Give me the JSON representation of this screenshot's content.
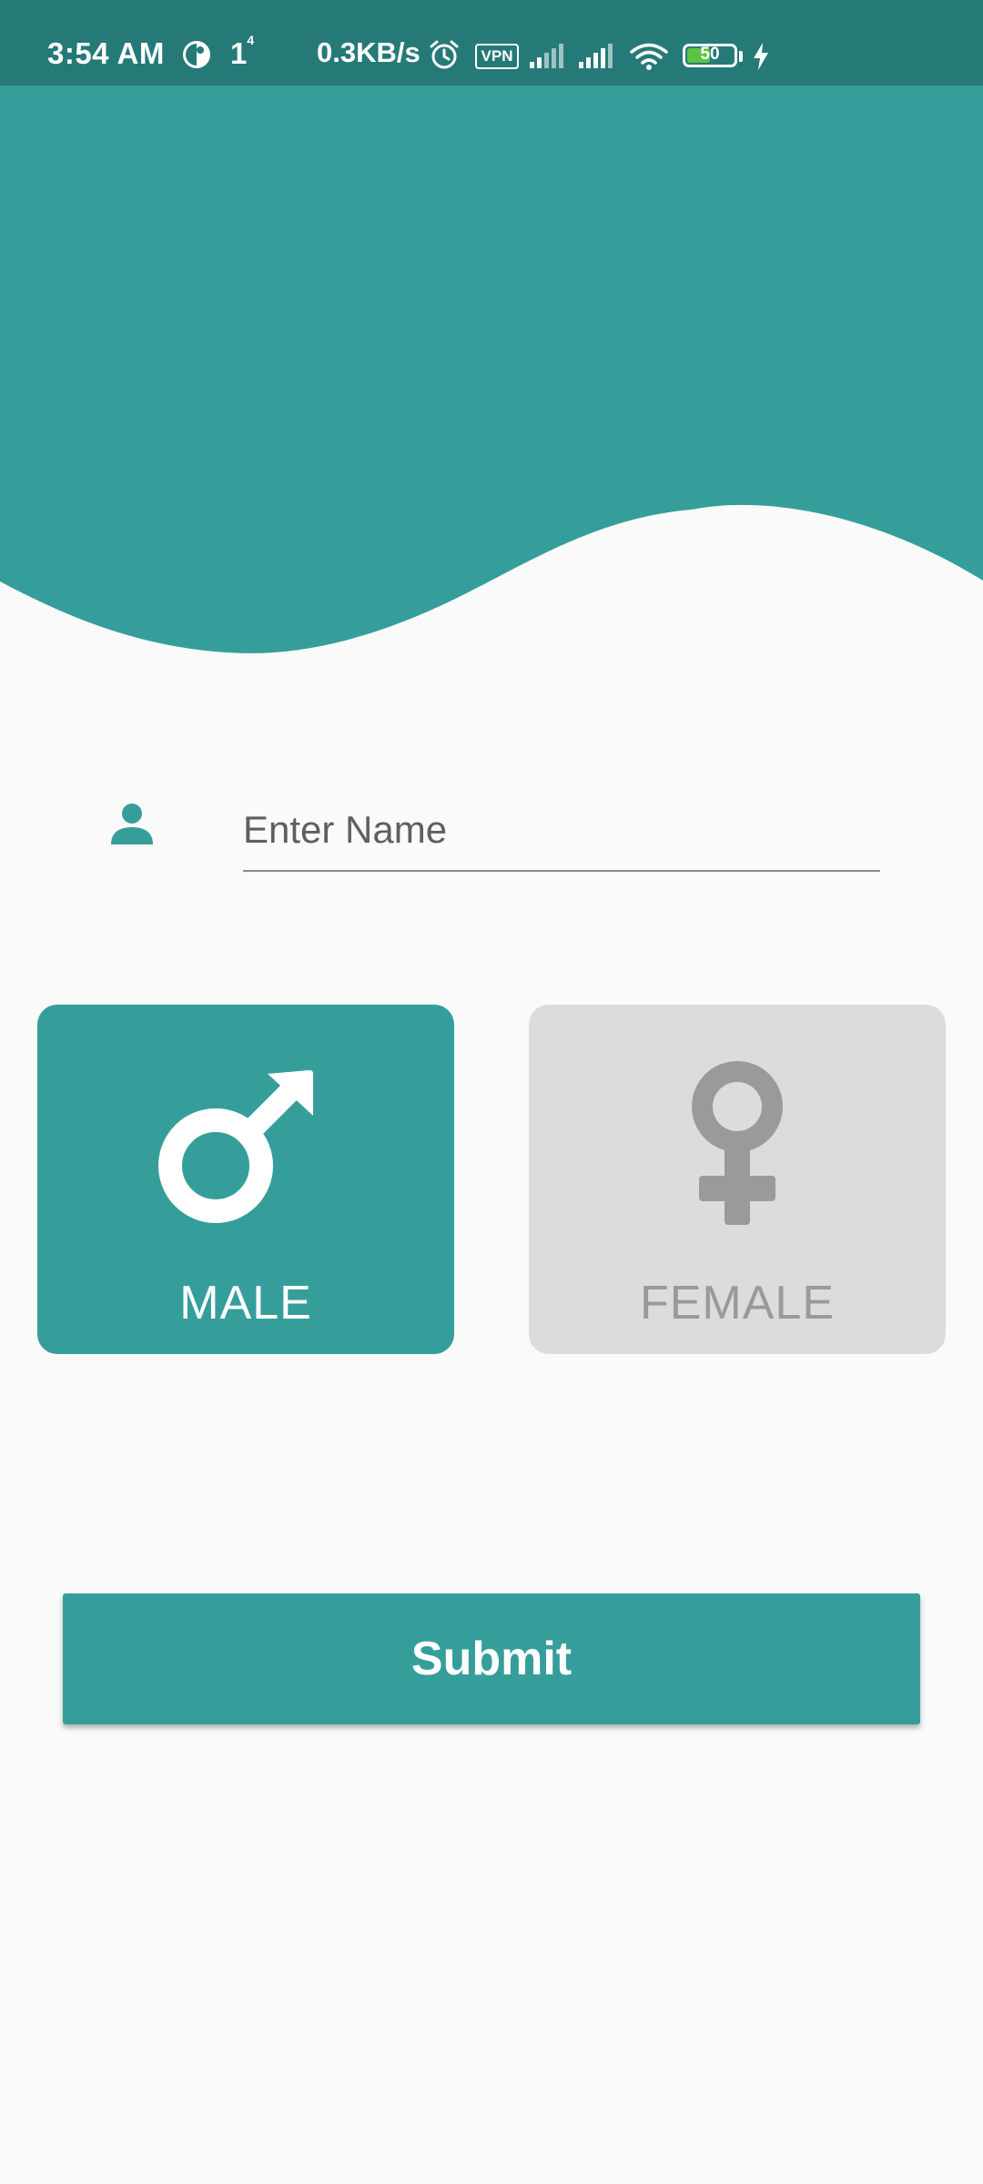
{
  "status_bar": {
    "time": "3:54 AM",
    "sim_indicator": "1",
    "sim_indicator_sup": "4",
    "net_speed": "0.3KB/s",
    "vpn_label": "VPN",
    "battery_level": "50",
    "battery_fraction": 0.5,
    "icons": [
      "data-saver-icon",
      "alarm-icon",
      "vpn-icon",
      "signal-icon",
      "signal-icon",
      "wifi-icon",
      "battery-icon",
      "charging-icon"
    ]
  },
  "form": {
    "name_placeholder": "Enter Name",
    "name_value": ""
  },
  "gender": {
    "male_label": "MALE",
    "female_label": "FEMALE",
    "selected": "male"
  },
  "actions": {
    "submit_label": "Submit"
  },
  "colors": {
    "accent": "#359e9b",
    "status_bar": "#257a78",
    "background": "#fafafa",
    "card_inactive": "#dcdcdc",
    "inactive_icon": "#9a9a9a"
  }
}
